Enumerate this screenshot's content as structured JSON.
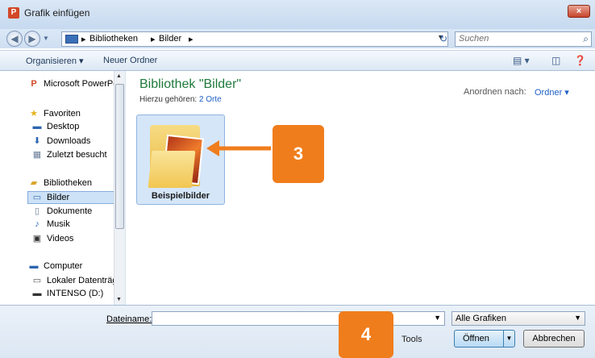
{
  "window": {
    "title": "Grafik einfügen",
    "app_badge": "P",
    "close": "×"
  },
  "address": {
    "crumbs": [
      "Bibliotheken",
      "Bilder"
    ],
    "search_placeholder": "Suchen"
  },
  "toolbar": {
    "organize": "Organisieren ▾",
    "new_folder": "Neuer Ordner"
  },
  "sidebar": {
    "items": [
      {
        "label": "Microsoft PowerPo",
        "icon": "powerpoint-icon"
      },
      {
        "label": "Favoriten",
        "icon": "star-icon"
      },
      {
        "label": "Desktop",
        "icon": "desktop-icon"
      },
      {
        "label": "Downloads",
        "icon": "downloads-icon"
      },
      {
        "label": "Zuletzt besucht",
        "icon": "recent-icon"
      },
      {
        "label": "Bibliotheken",
        "icon": "library-icon"
      },
      {
        "label": "Bilder",
        "icon": "pictures-icon"
      },
      {
        "label": "Dokumente",
        "icon": "documents-icon"
      },
      {
        "label": "Musik",
        "icon": "music-icon"
      },
      {
        "label": "Videos",
        "icon": "videos-icon"
      },
      {
        "label": "Computer",
        "icon": "computer-icon"
      },
      {
        "label": "Lokaler Datenträg",
        "icon": "drive-icon"
      },
      {
        "label": "INTENSO (D:)",
        "icon": "usb-drive-icon"
      }
    ]
  },
  "main": {
    "title": "Bibliothek \"Bilder\"",
    "subtitle_prefix": "Hierzu gehören:",
    "subtitle_link": "2 Orte",
    "arrange_label": "Anordnen nach:",
    "arrange_value": "Ordner ▾",
    "folder_label": "Beispielbilder"
  },
  "callouts": {
    "three": "3",
    "four": "4"
  },
  "bottom": {
    "filename_label": "Dateiname:",
    "filename_value": "",
    "filter_value": "Alle Grafiken",
    "tools_label": "Tools",
    "open_label": "Öffnen",
    "cancel_label": "Abbrechen"
  },
  "colors": {
    "accent_orange": "#f07d1c",
    "library_title": "#1e7a3a",
    "link": "#1f60c6"
  }
}
